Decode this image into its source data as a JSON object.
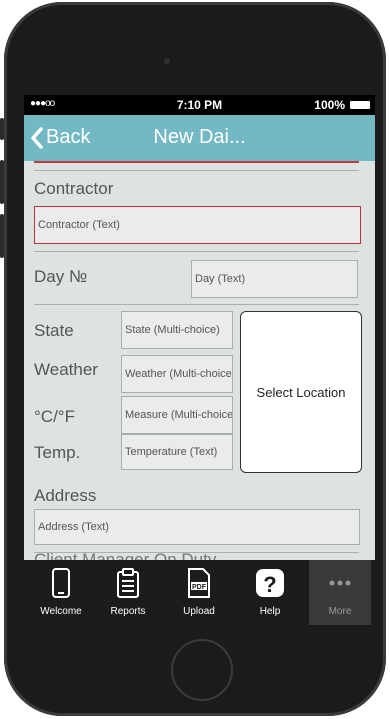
{
  "status": {
    "signal": "●●●oo",
    "time": "7:10 PM",
    "battery": "100%"
  },
  "nav": {
    "back_label": "Back",
    "title": "New Dai..."
  },
  "form": {
    "contractor_label": "Contractor",
    "contractor_placeholder": "Contractor (Text)",
    "day_label": "Day №",
    "day_placeholder": "Day (Text)",
    "state_label": "State",
    "state_placeholder": "State (Multi-choice)",
    "weather_label": "Weather",
    "weather_placeholder": "Weather (Multi-choice)",
    "measure_label": "°C/°F",
    "measure_placeholder": "Measure (Multi-choice)",
    "temp_label": "Temp.",
    "temp_placeholder": "Temperature (Text)",
    "select_location": "Select Location",
    "address_label": "Address",
    "address_placeholder": "Address (Text)",
    "next_section_label": "Client Manager On Duty"
  },
  "tabs": [
    {
      "label": "Welcome",
      "icon": "phone-icon"
    },
    {
      "label": "Reports",
      "icon": "clipboard-icon"
    },
    {
      "label": "Upload",
      "icon": "pdf-icon"
    },
    {
      "label": "Help",
      "icon": "question-icon"
    },
    {
      "label": "More",
      "icon": "more-dots-icon"
    }
  ],
  "colors": {
    "navbar": "#73b9c4",
    "background": "#dde3e1",
    "error_border": "#c0303a",
    "tabbar": "#1c1c1c"
  }
}
